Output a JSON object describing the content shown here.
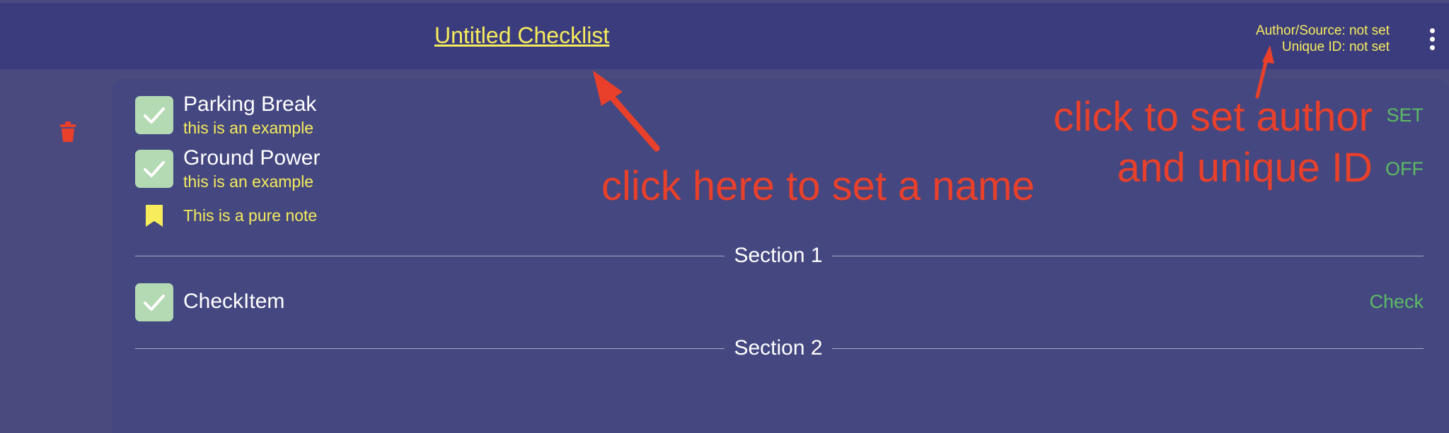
{
  "header": {
    "title": "Untitled Checklist",
    "author_line": "Author/Source: not set",
    "unique_id_line": "Unique ID: not set",
    "menu_icon": "more-vert-icon"
  },
  "sidebar": {
    "delete_icon": "trash-icon"
  },
  "items": [
    {
      "title": "Parking Break",
      "subtitle": "this is an example",
      "action": "SET",
      "icon": "checkbox-checked-icon"
    },
    {
      "title": "Ground Power",
      "subtitle": "this is an example",
      "action": "OFF",
      "icon": "checkbox-checked-icon"
    }
  ],
  "note": {
    "text": "This is a pure note",
    "icon": "bookmark-icon"
  },
  "sections": [
    {
      "label": "Section 1",
      "items": [
        {
          "title": "CheckItem",
          "action": "Check",
          "icon": "checkbox-checked-icon"
        }
      ]
    },
    {
      "label": "Section 2",
      "items": []
    }
  ],
  "annotations": {
    "name_hint": "click here to set a name",
    "author_hint_line1": "click to set author",
    "author_hint_line2": "and unique ID"
  },
  "colors": {
    "header_bg": "#3b3c7e",
    "card_bg": "#444780",
    "accent_yellow": "#f6ec5c",
    "action_green": "#5dbb63",
    "checkbox_green": "#b4dab4",
    "annotation_red": "#e8402b"
  }
}
